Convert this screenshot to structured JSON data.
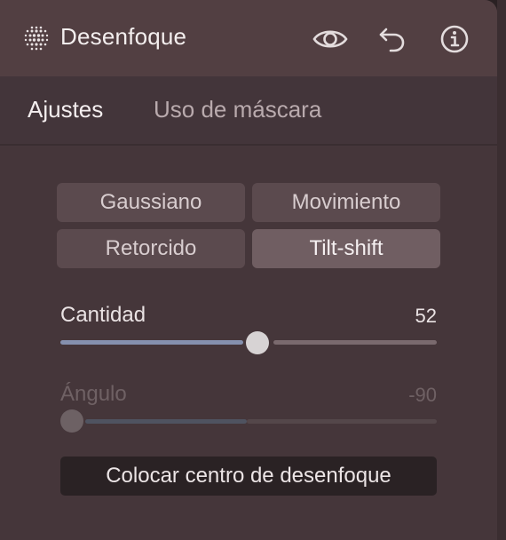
{
  "header": {
    "title": "Desenfoque",
    "icons": [
      "blur-dots-icon",
      "eye-icon",
      "undo-icon",
      "info-icon"
    ]
  },
  "tabs": [
    {
      "label": "Ajustes",
      "active": true
    },
    {
      "label": "Uso de máscara",
      "active": false
    }
  ],
  "blur_types": [
    {
      "label": "Gaussiano",
      "selected": false
    },
    {
      "label": "Movimiento",
      "selected": false
    },
    {
      "label": "Retorcido",
      "selected": false
    },
    {
      "label": "Tilt-shift",
      "selected": true
    }
  ],
  "sliders": {
    "amount": {
      "label": "Cantidad",
      "value": "52",
      "fraction": 0.52,
      "enabled": true
    },
    "angle": {
      "label": "Ángulo",
      "value": "-90",
      "fraction": 0.0,
      "enabled": false
    }
  },
  "action": {
    "label": "Colocar centro de desenfoque"
  },
  "colors": {
    "panel": "#45363a",
    "header": "#523f42",
    "track_fill": "#8590ae",
    "track_rest": "#7a6a6e",
    "thumb": "#d7d3d4"
  }
}
